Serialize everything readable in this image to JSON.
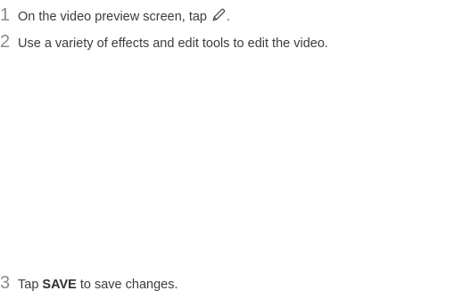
{
  "steps": [
    {
      "number": "1",
      "text_before": "On the video preview screen, tap",
      "icon": "pencil-icon",
      "text_after": "."
    },
    {
      "number": "2",
      "text": "Use a variety of effects and edit tools to edit the video."
    },
    {
      "number": "3",
      "text_before": "Tap ",
      "bold": "SAVE",
      "text_after": " to save changes."
    }
  ],
  "colors": {
    "step_number": "#8a8a8a",
    "body_text": "#3c3c3c"
  }
}
